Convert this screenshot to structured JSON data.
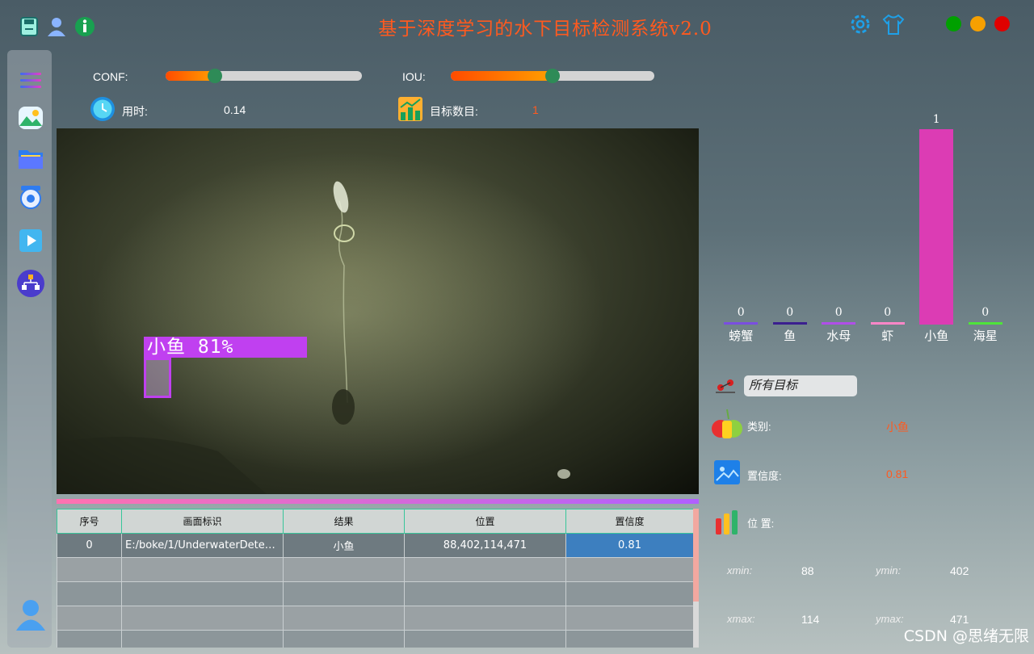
{
  "app": {
    "title": "基于深度学习的水下目标检测系统v2.0",
    "watermark": "CSDN @思绪无限"
  },
  "top_icons": [
    "save-icon",
    "user-icon",
    "info-icon",
    "settings-icon",
    "skin-icon"
  ],
  "window_controls": {
    "colors": [
      "#00a000",
      "#f6a000",
      "#e00000"
    ]
  },
  "sidebar": {
    "items": [
      "menu-icon",
      "image-icon",
      "folder-icon",
      "camera-icon",
      "video-icon",
      "model-icon"
    ],
    "bottom": "user-avatar-icon"
  },
  "controls": {
    "conf_label": "CONF:",
    "conf_value": 0.25,
    "iou_label": "IOU:",
    "iou_value": 0.5,
    "time_label": "用时:",
    "time_value": "0.14",
    "count_label": "目标数目:",
    "count_value": "1"
  },
  "detection": {
    "label": "小鱼  81%",
    "box_color": "#c040f0"
  },
  "table": {
    "headers": [
      "序号",
      "画面标识",
      "结果",
      "位置",
      "置信度"
    ],
    "rows": [
      [
        "0",
        "E:/boke/1/UnderwaterDetect...",
        "小鱼",
        "88,402,114,471",
        "0.81"
      ],
      [
        "",
        "",
        "",
        "",
        ""
      ],
      [
        "",
        "",
        "",
        "",
        ""
      ],
      [
        "",
        "",
        "",
        "",
        ""
      ],
      [
        "",
        "",
        "",
        "",
        ""
      ]
    ]
  },
  "chart_data": {
    "type": "bar",
    "categories": [
      "螃蟹",
      "鱼",
      "水母",
      "虾",
      "小鱼",
      "海星"
    ],
    "values": [
      0,
      0,
      0,
      0,
      1,
      0
    ],
    "colors": [
      "#7a4ee0",
      "#3b1f8f",
      "#b04ee8",
      "#ff86c8",
      "#dc3cb4",
      "#4ee43a"
    ],
    "ylim": [
      0,
      1
    ]
  },
  "info": {
    "target_select": "所有目标",
    "class_label": "类别:",
    "class_value": "小鱼",
    "conf_label": "置信度:",
    "conf_value": "0.81",
    "pos_label": "位 置:",
    "xmin_label": "xmin:",
    "xmin": "88",
    "ymin_label": "ymin:",
    "ymin": "402",
    "xmax_label": "xmax:",
    "xmax": "114",
    "ymax_label": "ymax:",
    "ymax": "471"
  }
}
